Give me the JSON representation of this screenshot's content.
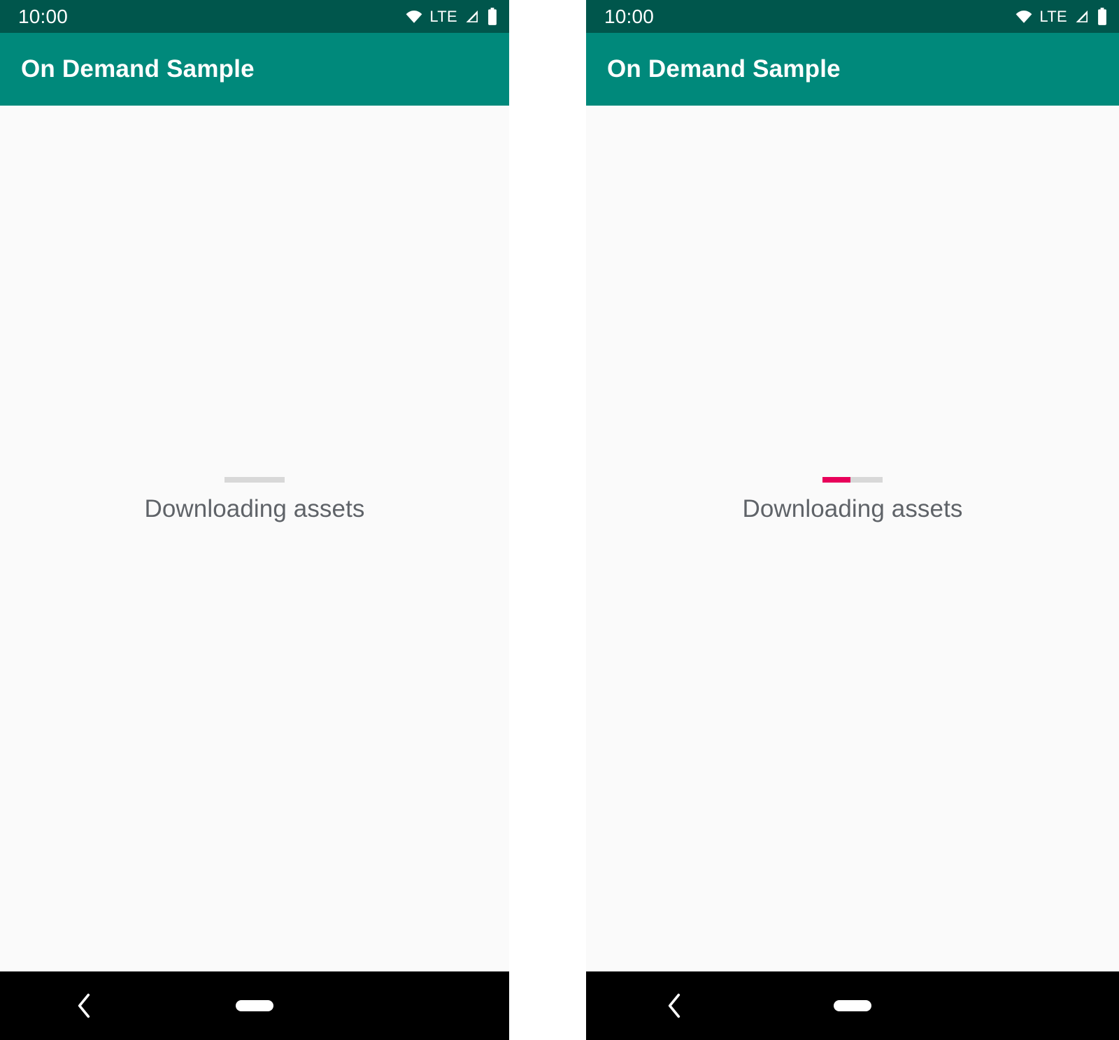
{
  "colors": {
    "status_bar": "#00564C",
    "toolbar": "#00897B",
    "content_background": "#FAFAFA",
    "progress_track": "#D8D8D8",
    "progress_accent": "#E8005A",
    "label_text": "#5F6368",
    "nav_bar": "#000000"
  },
  "panels": [
    {
      "id": "left",
      "status_bar": {
        "time": "10:00",
        "icons": [
          "wifi-icon",
          "lte-label",
          "cellular-signal-icon",
          "battery-icon"
        ],
        "lte_label": "LTE"
      },
      "toolbar": {
        "title": "On Demand Sample"
      },
      "content": {
        "progress": {
          "value": 0,
          "max": 100,
          "indeterminate": false
        },
        "status_text": "Downloading assets"
      },
      "navigation_bar": {
        "back_label": "Back",
        "home_label": "Home"
      }
    },
    {
      "id": "right",
      "status_bar": {
        "time": "10:00",
        "icons": [
          "wifi-icon",
          "lte-label",
          "cellular-signal-icon",
          "battery-icon"
        ],
        "lte_label": "LTE"
      },
      "toolbar": {
        "title": "On Demand Sample"
      },
      "content": {
        "progress": {
          "value": 47,
          "max": 100,
          "indeterminate": false
        },
        "status_text": "Downloading assets"
      },
      "navigation_bar": {
        "back_label": "Back",
        "home_label": "Home"
      }
    }
  ]
}
